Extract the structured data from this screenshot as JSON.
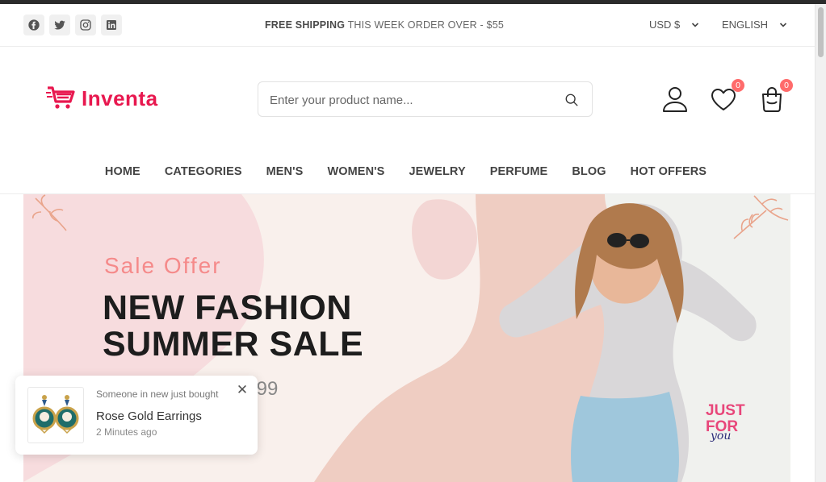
{
  "topbar": {
    "social_icons": [
      "facebook-icon",
      "twitter-icon",
      "instagram-icon",
      "linkedin-icon"
    ],
    "shipping_strong": "FREE SHIPPING",
    "shipping_rest": " THIS WEEK ORDER OVER - $55",
    "currency": "USD $",
    "language": "ENGLISH"
  },
  "header": {
    "brand": "Inventa",
    "brand_color": "#e8184f",
    "search_placeholder": "Enter your product name...",
    "wishlist_count": "0",
    "cart_count": "0",
    "badge_color": "#ff6b6b"
  },
  "nav": {
    "items": [
      "HOME",
      "CATEGORIES",
      "MEN'S",
      "WOMEN'S",
      "JEWELRY",
      "PERFUME",
      "BLOG",
      "HOT OFFERS"
    ]
  },
  "hero": {
    "subtitle": "Sale Offer",
    "headline_line1": "NEW FASHION",
    "headline_line2": "SUMMER SALE",
    "price_fragment": ".99",
    "tag_line1": "JUST",
    "tag_line2": "FOR",
    "tag_line3": "you"
  },
  "toast": {
    "meta": "Someone in new just bought",
    "product": "Rose Gold Earrings",
    "time": "2 Minutes ago",
    "close": "✕"
  }
}
